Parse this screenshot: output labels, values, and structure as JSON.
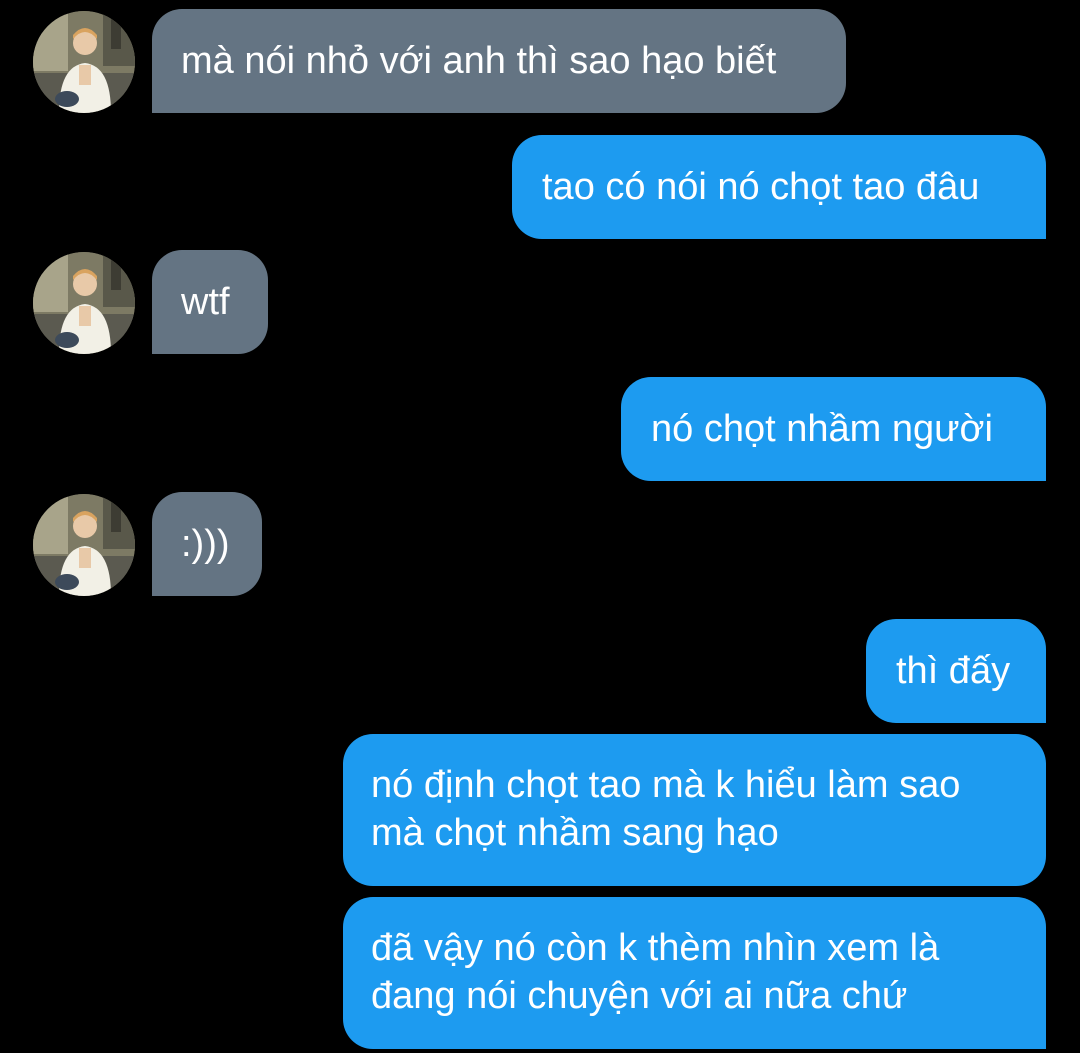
{
  "theme": {
    "background": "#000000",
    "incoming_bubble": "#647483",
    "outgoing_bubble": "#1d9bf0",
    "text": "#ffffff"
  },
  "contact": {
    "avatar_icon": "profile-photo-avatar"
  },
  "messages": [
    {
      "direction": "incoming",
      "text": "mà nói nhỏ với anh thì sao hạo biết"
    },
    {
      "direction": "outgoing",
      "text": "tao có nói nó chọt tao đâu"
    },
    {
      "direction": "incoming",
      "text": "wtf"
    },
    {
      "direction": "outgoing",
      "text": "nó chọt nhầm người"
    },
    {
      "direction": "incoming",
      "text": ":)))"
    },
    {
      "direction": "outgoing",
      "text": "thì đấy"
    },
    {
      "direction": "outgoing",
      "lines": [
        "nó định chọt tao mà k hiểu làm sao",
        "mà chọt nhầm sang hạo"
      ]
    },
    {
      "direction": "outgoing",
      "lines": [
        "đã vậy nó còn k thèm nhìn xem là",
        "đang nói chuyện với ai nữa chứ"
      ]
    }
  ]
}
